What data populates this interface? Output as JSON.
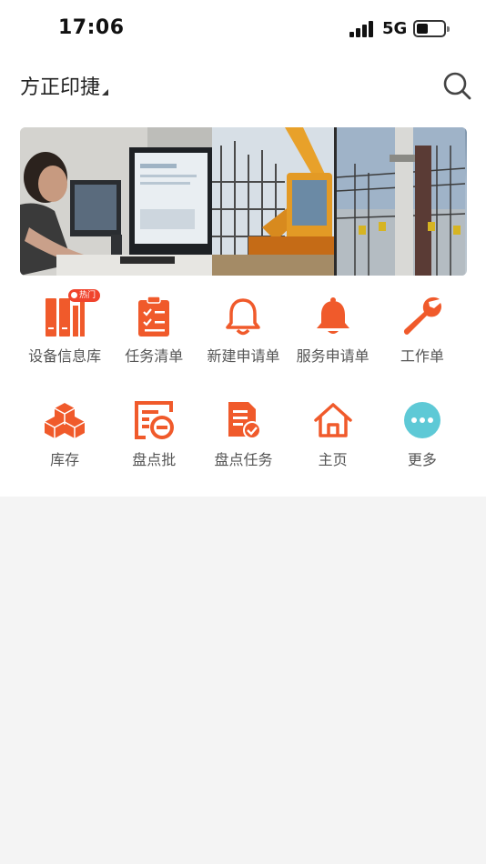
{
  "status_bar": {
    "time": "17:06",
    "network": "5G",
    "battery_level": 0.35
  },
  "header": {
    "org_name": "方正印捷",
    "icons": {
      "search": "search-icon",
      "caret": "dropdown-caret-icon"
    }
  },
  "banner": {
    "panels": [
      "office-worker-photo",
      "construction-excavator-photo",
      "power-substation-photo"
    ]
  },
  "grid": {
    "hot_badge": "热门",
    "accent_color": "#f05a2b",
    "items": [
      {
        "label": "设备信息库",
        "icon": "books-icon"
      },
      {
        "label": "任务清单",
        "icon": "checklist-icon"
      },
      {
        "label": "新建申请单",
        "icon": "bell-outline-icon"
      },
      {
        "label": "服务申请单",
        "icon": "bell-solid-icon"
      },
      {
        "label": "工作单",
        "icon": "wrench-icon"
      },
      {
        "label": "库存",
        "icon": "boxes-icon"
      },
      {
        "label": "盘点批",
        "icon": "batch-count-icon"
      },
      {
        "label": "盘点任务",
        "icon": "document-check-icon"
      },
      {
        "label": "主页",
        "icon": "home-icon"
      },
      {
        "label": "更多",
        "icon": "more-icon"
      }
    ]
  }
}
